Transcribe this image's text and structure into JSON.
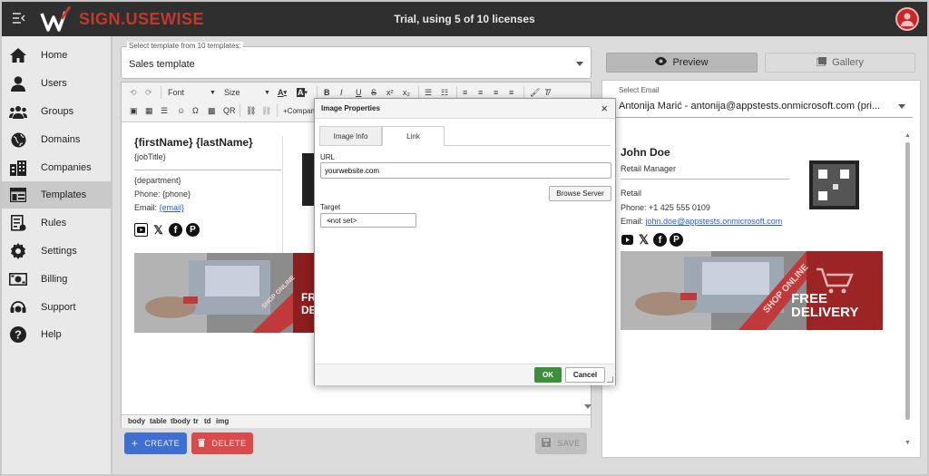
{
  "header": {
    "brand": "SIGN.USEWISE",
    "trial_text": "Trial, using 5 of 10 licenses"
  },
  "sidebar": {
    "items": [
      {
        "label": "Home",
        "icon": "home-icon"
      },
      {
        "label": "Users",
        "icon": "user-icon"
      },
      {
        "label": "Groups",
        "icon": "groups-icon"
      },
      {
        "label": "Domains",
        "icon": "globe-icon"
      },
      {
        "label": "Companies",
        "icon": "building-icon"
      },
      {
        "label": "Templates",
        "icon": "template-icon",
        "active": true
      },
      {
        "label": "Rules",
        "icon": "rules-icon"
      },
      {
        "label": "Settings",
        "icon": "gear-icon"
      },
      {
        "label": "Billing",
        "icon": "money-icon"
      },
      {
        "label": "Support",
        "icon": "headset-icon"
      },
      {
        "label": "Help",
        "icon": "help-icon"
      }
    ]
  },
  "template_select": {
    "label": "Select template from 10 templates:",
    "value": "Sales template"
  },
  "toolbar": {
    "font": "Font",
    "size": "Size",
    "qr": "QR",
    "company": "+Compan"
  },
  "editor": {
    "name": "{firstName} {lastName}",
    "job_title": "{jobTitle}",
    "department": "{department}",
    "phone": "Phone: {phone}",
    "email_label": "Email:",
    "email_value": "{email}",
    "banner_text_1": "FRE",
    "banner_text_2": "DE",
    "banner_stripe": "SHOP ONLINE",
    "path": [
      "body",
      "table",
      "tbody",
      "tr",
      "td",
      "img"
    ]
  },
  "buttons": {
    "create": "CREATE",
    "delete": "DELETE",
    "save": "SAVE"
  },
  "preview": {
    "preview_tab": "Preview",
    "gallery_tab": "Gallery",
    "email_label": "Select Email",
    "email_value": "Antonija Marić - antonija@appstests.onmicrosoft.com (pri...",
    "name": "John Doe",
    "title": "Retail Manager",
    "department": "Retail",
    "phone": "Phone: +1 425 555 0109",
    "email_label_text": "Email:",
    "email": "john.doe@appstests.onmicrosoft.com",
    "banner_stripe": "SHOP ONLINE",
    "banner_line_1": "FREE",
    "banner_line_2": "DELIVERY"
  },
  "modal": {
    "title": "Image Properties",
    "tabs": [
      "Image Info",
      "Link"
    ],
    "active_tab": "Link",
    "url_label": "URL",
    "url_value": "yourwebsite.com",
    "browse": "Browse Server",
    "target_label": "Target",
    "target_value": "<not set>",
    "ok": "OK",
    "cancel": "Cancel"
  },
  "colors": {
    "topbar": "#2f2f2f",
    "brand_red": "#c0392b",
    "create_blue": "#3f6fd1",
    "delete_red": "#d94b4b",
    "ok_green": "#3e8e3e",
    "banner_red": "#c0393b"
  }
}
